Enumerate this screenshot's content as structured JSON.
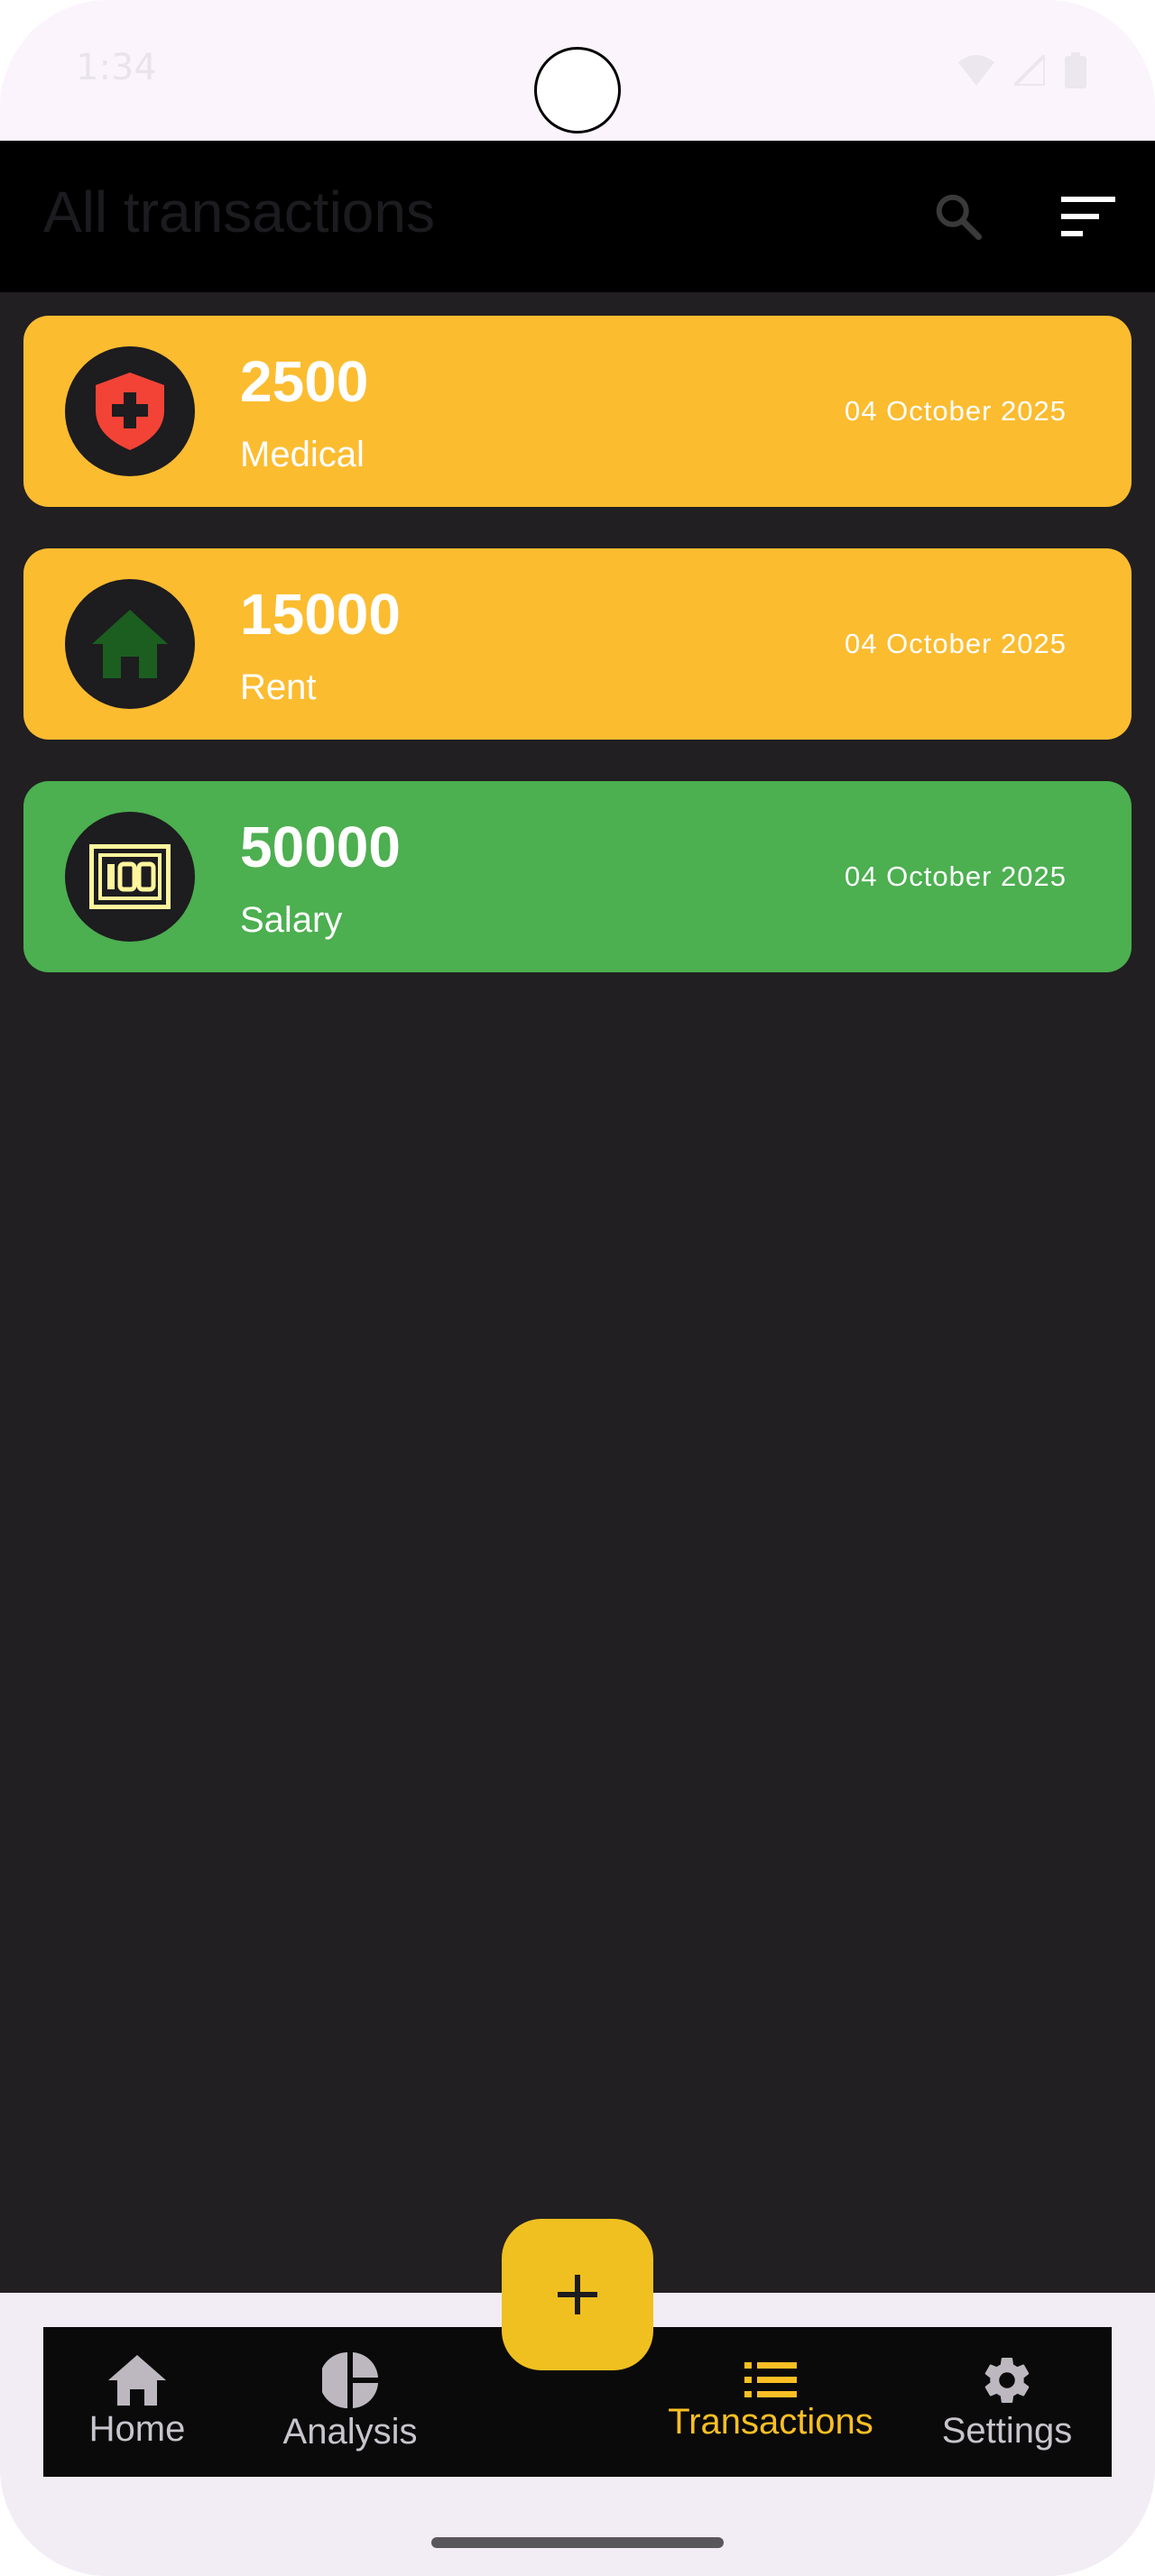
{
  "status_bar": {
    "time": "1:34"
  },
  "app_bar": {
    "title": "All transactions",
    "search_icon": "search-icon",
    "filter_icon": "filter-list-icon"
  },
  "transactions": [
    {
      "amount": "2500",
      "category": "Medical",
      "date": "04 October 2025",
      "icon": "medical-shield-icon",
      "color": "#fbbc30"
    },
    {
      "amount": "15000",
      "category": "Rent",
      "date": "04 October 2025",
      "icon": "house-icon",
      "color": "#fbbc30"
    },
    {
      "amount": "50000",
      "category": "Salary",
      "date": "04 October 2025",
      "icon": "cash-100-icon",
      "color": "#4caf50"
    }
  ],
  "fab": {
    "icon": "add-icon",
    "label": "+"
  },
  "bottom_nav": {
    "items": [
      {
        "label": "Home",
        "icon": "home-icon",
        "active": false
      },
      {
        "label": "Analysis",
        "icon": "pie-chart-icon",
        "active": false
      },
      {
        "label": "Transactions",
        "icon": "list-icon",
        "active": true
      },
      {
        "label": "Settings",
        "icon": "gear-icon",
        "active": false
      }
    ]
  },
  "colors": {
    "accent": "#fbbf24",
    "expense": "#fbbc30",
    "income": "#4caf50",
    "background": "#211f21"
  }
}
